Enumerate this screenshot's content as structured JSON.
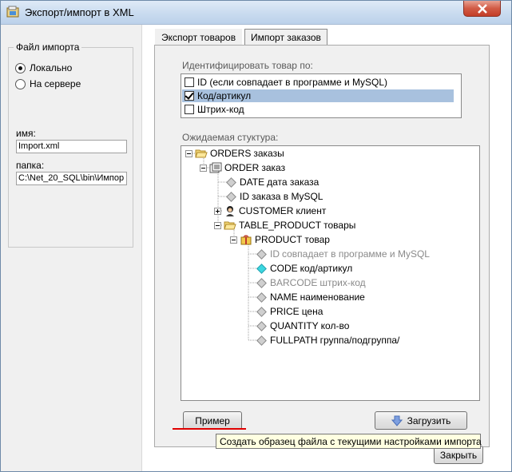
{
  "window": {
    "title": "Экспорт/импорт в XML"
  },
  "left": {
    "group_title": "Файл импорта",
    "radio_local": "Локально",
    "radio_server": "На сервере",
    "name_label": "имя:",
    "name_value": "Import.xml",
    "folder_label": "папка:",
    "folder_value": "C:\\Net_20_SQL\\bin\\Импор"
  },
  "tabs": [
    "Экспорт товаров",
    "Импорт заказов"
  ],
  "identify": {
    "label": "Идентифицировать товар по:",
    "items": [
      {
        "label": "ID  (если совпадает в программе и MySQL)",
        "checked": false,
        "selected": false
      },
      {
        "label": "Код/артикул",
        "checked": true,
        "selected": true
      },
      {
        "label": "Штрих-код",
        "checked": false,
        "selected": false
      }
    ]
  },
  "structure": {
    "label": "Ожидаемая стуктура:",
    "nodes": [
      {
        "name": "ORDERS",
        "desc": "заказы"
      },
      {
        "name": "ORDER",
        "desc": "заказ"
      },
      {
        "name": "DATE",
        "desc": "дата заказа"
      },
      {
        "name": "ID",
        "desc": "заказа в MySQL"
      },
      {
        "name": "CUSTOMER",
        "desc": "клиент"
      },
      {
        "name": "TABLE_PRODUCT",
        "desc": "товары"
      },
      {
        "name": "PRODUCT",
        "desc": "товар"
      },
      {
        "name": "ID",
        "desc": "совпадает в программе и MySQL"
      },
      {
        "name": "CODE",
        "desc": "код/артикул"
      },
      {
        "name": "BARCODE",
        "desc": "штрих-код"
      },
      {
        "name": "NAME",
        "desc": "наименование"
      },
      {
        "name": "PRICE",
        "desc": "цена"
      },
      {
        "name": "QUANTITY",
        "desc": "кол-во"
      },
      {
        "name": "FULLPATH",
        "desc": "группа/подгруппа/"
      }
    ]
  },
  "buttons": {
    "example": "Пример",
    "load": "Загрузить",
    "close": "Закрыть"
  },
  "tooltip": "Создать образец файла с текущими настройками импорта",
  "colors": {
    "selection": "#a8c1de",
    "accent_cyan": "#3ad7e0",
    "underline_red": "#e00000",
    "tooltip_bg": "#ffffe1"
  }
}
